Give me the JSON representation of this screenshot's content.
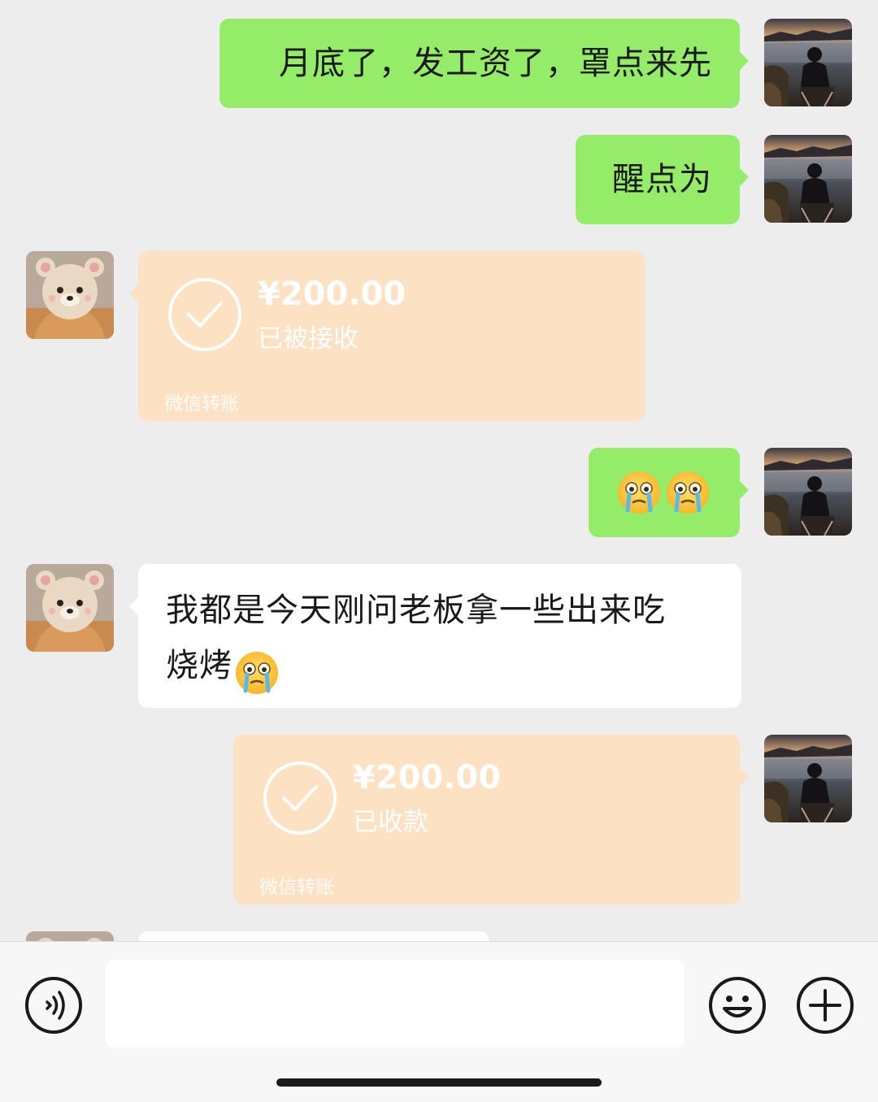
{
  "messages": [
    {
      "id": "m1",
      "side": "right",
      "type": "text",
      "text": "月底了，发工资了，罩点来先"
    },
    {
      "id": "m2",
      "side": "right",
      "type": "text",
      "text": "醒点为"
    },
    {
      "id": "m3",
      "side": "left",
      "type": "transfer",
      "amount": "¥200.00",
      "status": "已被接收",
      "footer": "微信转账"
    },
    {
      "id": "m4",
      "side": "right",
      "type": "emoji",
      "emojis": [
        "crying-face-emoji",
        "crying-face-emoji"
      ]
    },
    {
      "id": "m5",
      "side": "left",
      "type": "text",
      "line1": "我都是今天刚问老板拿一些出来吃",
      "line2": "烧烤",
      "emoji": "crying-face-emoji"
    },
    {
      "id": "m6",
      "side": "right",
      "type": "transfer",
      "amount": "¥200.00",
      "status": "已收款",
      "footer": "微信转账"
    }
  ],
  "input": {
    "placeholder": "",
    "value": ""
  },
  "icons": {
    "voice": "voice-icon",
    "emoji": "emoji-icon",
    "more": "plus-icon"
  },
  "colors": {
    "background": "#ededed",
    "bubble_self": "#95ec69",
    "bubble_other": "#ffffff",
    "transfer": "#fde1c3",
    "text": "#1a1a1a"
  }
}
